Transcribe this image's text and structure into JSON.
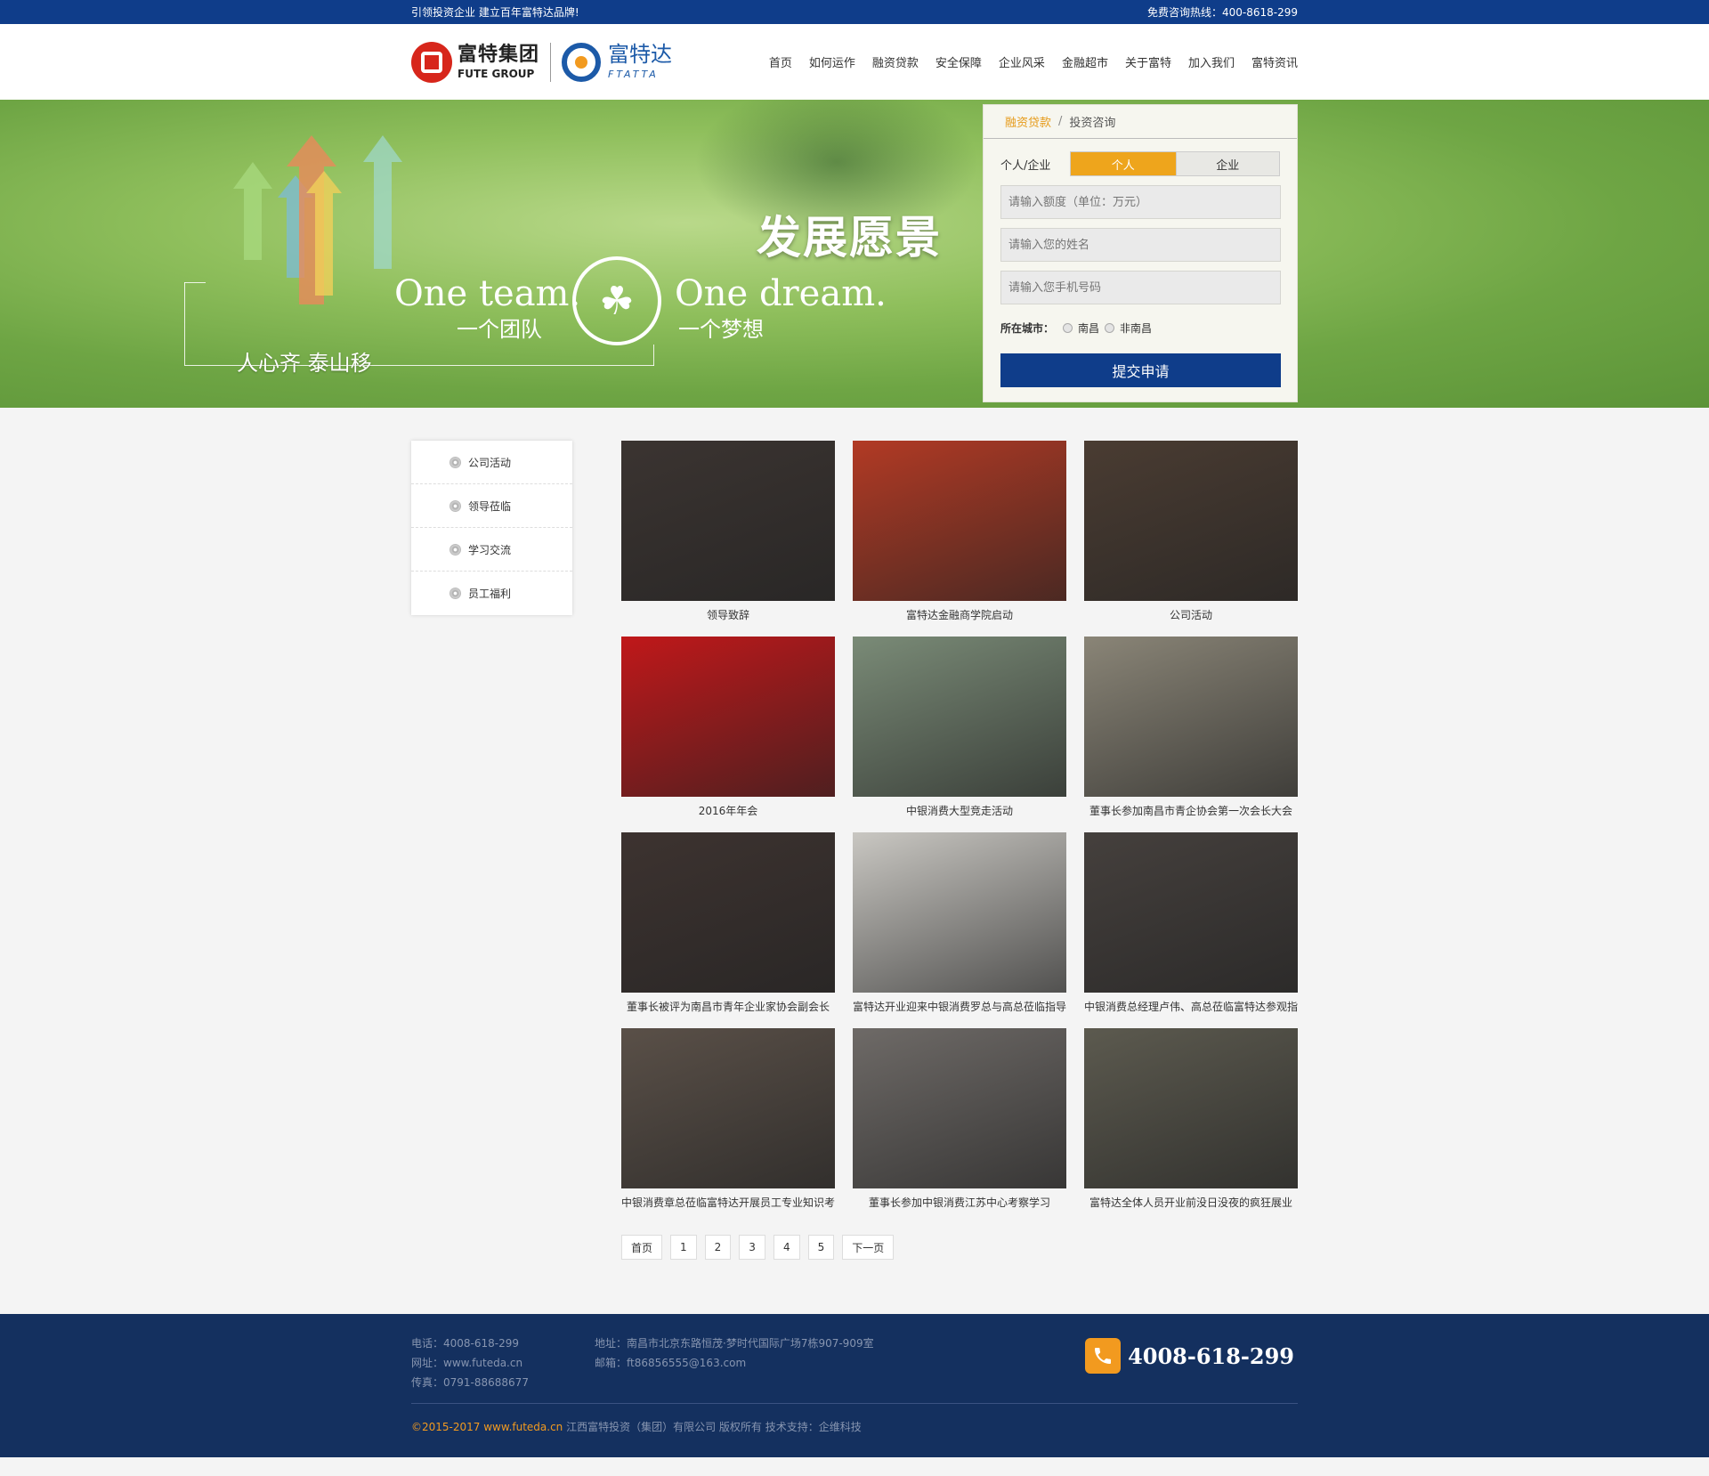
{
  "topbar": {
    "slogan": "引领投资企业 建立百年富特达品牌!",
    "hotline": "免费咨询热线：400-8618-299"
  },
  "logo": {
    "group_cn": "富特集团",
    "group_en": "FUTE GROUP",
    "brand_cn": "富特达",
    "brand_en": "FTATTA"
  },
  "nav": [
    "首页",
    "如何运作",
    "融资贷款",
    "安全保障",
    "企业风采",
    "金融超市",
    "关于富特",
    "加入我们",
    "富特资讯"
  ],
  "banner": {
    "headline": "发展愿景",
    "en1": "One team.",
    "cn1": "一个团队",
    "en2": "One dream.",
    "cn2": "一个梦想",
    "cn3": "人心齐 泰山移"
  },
  "form": {
    "tab_active": "融资贷款",
    "tab_sep": "/",
    "tab_other": "投资咨询",
    "type_label": "个人/企业",
    "type_personal": "个人",
    "type_company": "企业",
    "amount_placeholder": "请输入额度（单位：万元）",
    "name_placeholder": "请输入您的姓名",
    "phone_placeholder": "请输入您手机号码",
    "city_label": "所在城市：",
    "city_a": "南昌",
    "city_b": "非南昌",
    "submit": "提交申请"
  },
  "sidebar": [
    "公司活动",
    "领导莅临",
    "学习交流",
    "员工福利"
  ],
  "gallery": [
    {
      "caption": "领导致辞",
      "tone": "#3b3431"
    },
    {
      "caption": "富特达金融商学院启动",
      "tone": "#b23a24"
    },
    {
      "caption": "公司活动",
      "tone": "#4a3c32"
    },
    {
      "caption": "2016年年会",
      "tone": "#c0181a"
    },
    {
      "caption": "中银消费大型竞走活动",
      "tone": "#7a8b77"
    },
    {
      "caption": "董事长参加南昌市青企协会第一次会长大会",
      "tone": "#8a8577"
    },
    {
      "caption": "董事长被评为南昌市青年企业家协会副会长",
      "tone": "#3d3330"
    },
    {
      "caption": "富特达开业迎来中银消费罗总与高总莅临指导",
      "tone": "#c9c7c2"
    },
    {
      "caption": "中银消费总经理卢伟、高总莅临富特达参观指导",
      "tone": "#45403d"
    },
    {
      "caption": "中银消费章总莅临富特达开展员工专业知识考",
      "tone": "#5a5048"
    },
    {
      "caption": "董事长参加中银消费江苏中心考察学习",
      "tone": "#6e6a67"
    },
    {
      "caption": "富特达全体人员开业前没日没夜的疯狂展业",
      "tone": "#5c5a4f"
    }
  ],
  "pager": [
    "首页",
    "1",
    "2",
    "3",
    "4",
    "5",
    "下一页"
  ],
  "footer": {
    "tel": "电话：4008-618-299",
    "web": "网址：www.futeda.cn",
    "fax": "传真：0791-88688677",
    "address": "地址：南昌市北京东路恒茂·梦时代国际广场7栋907-909室",
    "email": "邮箱：ft86856555@163.com",
    "phone_big": "4008-618-299",
    "copy_year": "©2015-2017 www.futeda.cn",
    "copy_rest": " 江西富特投资（集团）有限公司 版权所有   技术支持：企维科技"
  },
  "colors": {
    "brand_blue": "#0f3d8a",
    "accent_orange": "#eea51c",
    "footer_bg": "#14305f"
  }
}
